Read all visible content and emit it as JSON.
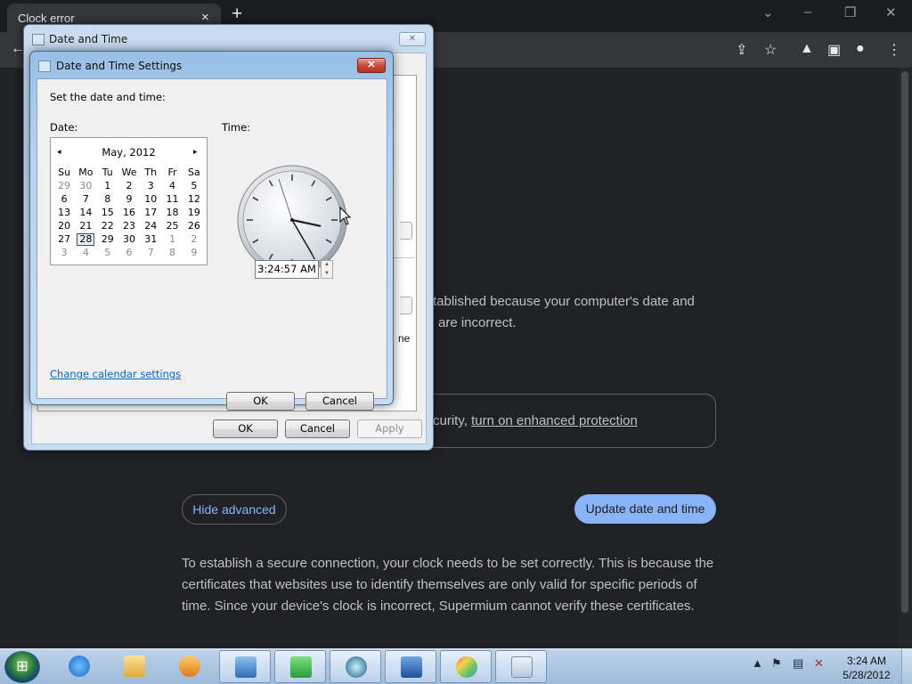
{
  "browser": {
    "tab_title": "Clock error",
    "tab_close": "×",
    "new_tab": "+",
    "controls": {
      "dropdown": "⌄",
      "minimize": "–",
      "restore": "❐",
      "close": "✕"
    }
  },
  "page": {
    "fragment_1_line1": "tablished because your computer's date and",
    "fragment_1_line2": "are incorrect.",
    "protection_prefix": "curity, ",
    "protection_link": "turn on enhanced protection",
    "hide_advanced": "Hide advanced",
    "update_date_time": "Update date and time",
    "explanation_line1": "To establish a secure connection, your clock needs to be set correctly. This is because the",
    "explanation_line2": "certificates that websites use to identify themselves are only valid for specific periods of",
    "explanation_line3": "time. Since your device's clock is incorrect, Supermium cannot verify these certificates."
  },
  "outer_dialog": {
    "title": "Date and Time",
    "close": "✕",
    "fragment_text": "ne",
    "ok": "OK",
    "cancel": "Cancel",
    "apply": "Apply"
  },
  "inner_dialog": {
    "title": "Date and Time Settings",
    "close": "✕",
    "heading": "Set the date and time:",
    "date_label": "Date:",
    "time_label": "Time:",
    "calendar": {
      "month_year": "May, 2012",
      "prev": "◂",
      "next": "▸",
      "weekdays": [
        "Su",
        "Mo",
        "Tu",
        "We",
        "Th",
        "Fr",
        "Sa"
      ],
      "weeks": [
        [
          "29",
          "30",
          "1",
          "2",
          "3",
          "4",
          "5"
        ],
        [
          "6",
          "7",
          "8",
          "9",
          "10",
          "11",
          "12"
        ],
        [
          "13",
          "14",
          "15",
          "16",
          "17",
          "18",
          "19"
        ],
        [
          "20",
          "21",
          "22",
          "23",
          "24",
          "25",
          "26"
        ],
        [
          "27",
          "28",
          "29",
          "30",
          "31",
          "1",
          "2"
        ],
        [
          "3",
          "4",
          "5",
          "6",
          "7",
          "8",
          "9"
        ]
      ],
      "selected": "28"
    },
    "time_value": "3:24:57 AM",
    "clock_hands": {
      "hour": 3,
      "minute": 24,
      "second": 57
    },
    "change_calendar_link": "Change calendar settings",
    "ok": "OK",
    "cancel": "Cancel"
  },
  "taskbar": {
    "time": "3:24 AM",
    "date": "5/28/2012",
    "tray_up": "▲"
  }
}
